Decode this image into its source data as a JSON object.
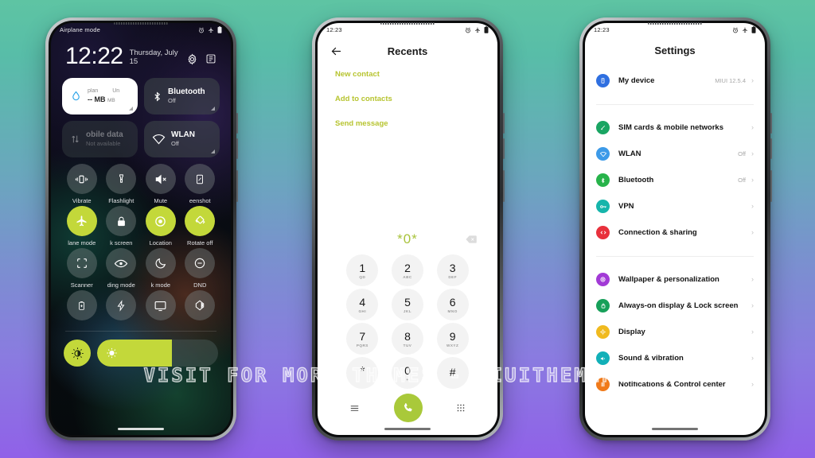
{
  "background": {
    "top_color": "#5ec4a3",
    "bottom_color": "#9061e8"
  },
  "watermark": {
    "text": "VISIT  FOR  MORE  THEMES  -  MIUITHEMER.COM"
  },
  "accent": {
    "lime": "#c3d83a",
    "lime_text": "#a9c33c"
  },
  "phone1": {
    "name": "control-center",
    "status": {
      "label": "Airplane mode",
      "icons": [
        "alarm-icon",
        "airplane-icon",
        "battery-icon"
      ]
    },
    "clock": {
      "time": "12:22",
      "date": "Thursday, July 15"
    },
    "header_icons": [
      "settings-gear-icon",
      "notes-icon"
    ],
    "big_tiles": [
      {
        "title": "plan",
        "title_right": "Un",
        "amount": "-- MB",
        "icon": "data-drop-icon",
        "style": "light"
      },
      {
        "title": "Bluetooth",
        "sub": "Off",
        "icon": "bluetooth-icon",
        "style": "dark"
      },
      {
        "title": "obile data",
        "sub": "Not available",
        "icon": "mobile-data-icon",
        "style": "dim"
      },
      {
        "title": "WLAN",
        "sub": "Off",
        "icon": "wifi-icon",
        "style": "dark"
      }
    ],
    "toggles": [
      {
        "label": "Vibrate",
        "icon": "vibrate-icon",
        "on": false
      },
      {
        "label": "Flashlight",
        "icon": "flashlight-icon",
        "on": false
      },
      {
        "label": "Mute",
        "icon": "mute-icon",
        "on": false
      },
      {
        "label": "eenshot",
        "icon": "screenshot-icon",
        "on": false
      },
      {
        "label": "lane mode",
        "icon": "airplane-icon",
        "on": true
      },
      {
        "label": "k screen",
        "icon": "lock-icon",
        "on": false
      },
      {
        "label": "Location",
        "icon": "location-icon",
        "on": true
      },
      {
        "label": "Rotate off",
        "icon": "rotate-icon",
        "on": true
      },
      {
        "label": "Scanner",
        "icon": "scanner-icon",
        "on": false
      },
      {
        "label": "ding mode",
        "icon": "eye-icon",
        "on": false
      },
      {
        "label": "k mode",
        "icon": "moon-icon",
        "on": false
      },
      {
        "label": "DND",
        "icon": "dnd-icon",
        "on": false
      },
      {
        "label": "",
        "icon": "battery-saver-icon",
        "on": false
      },
      {
        "label": "",
        "icon": "flash-icon",
        "on": false
      },
      {
        "label": "",
        "icon": "cast-icon",
        "on": false
      },
      {
        "label": "",
        "icon": "contrast-icon",
        "on": false
      }
    ],
    "brightness": {
      "button_icon": "auto-brightness-icon",
      "slider_icon": "sun-icon",
      "level_percent": 62
    }
  },
  "phone2": {
    "name": "dialer",
    "status": {
      "time": "12:23",
      "icons": [
        "alarm-icon",
        "airplane-icon",
        "battery-icon"
      ]
    },
    "title": "Recents",
    "back_icon": "back-arrow-icon",
    "links": [
      "New contact",
      "Add to contacts",
      "Send message"
    ],
    "dial_value": "*0*",
    "delete_icon": "backspace-icon",
    "keys": [
      {
        "num": "1",
        "sub": "QD"
      },
      {
        "num": "2",
        "sub": "ABC"
      },
      {
        "num": "3",
        "sub": "DEF"
      },
      {
        "num": "4",
        "sub": "GHI"
      },
      {
        "num": "5",
        "sub": "JKL"
      },
      {
        "num": "6",
        "sub": "MNO"
      },
      {
        "num": "7",
        "sub": "PQRS"
      },
      {
        "num": "8",
        "sub": "TUV"
      },
      {
        "num": "9",
        "sub": "WXYZ"
      },
      {
        "num": "*",
        "sub": ""
      },
      {
        "num": "0",
        "sub": "+"
      },
      {
        "num": "#",
        "sub": ""
      }
    ],
    "bottom": {
      "menu_icon": "menu-icon",
      "call_icon": "call-icon",
      "keypad_icon": "keypad-icon"
    }
  },
  "phone3": {
    "name": "settings",
    "status": {
      "time": "12:23",
      "icons": [
        "alarm-icon",
        "airplane-icon",
        "battery-icon"
      ]
    },
    "title": "Settings",
    "groups": [
      {
        "rows": [
          {
            "label": "My device",
            "value": "MIUI 12.5.4",
            "icon": "device-icon",
            "color": "#2f6fe0"
          }
        ]
      },
      {
        "rows": [
          {
            "label": "SIM cards & mobile networks",
            "value": "",
            "icon": "sim-icon",
            "color": "#1aa563"
          },
          {
            "label": "WLAN",
            "value": "Off",
            "icon": "wifi-icon",
            "color": "#3d9ae8"
          },
          {
            "label": "Bluetooth",
            "value": "Off",
            "icon": "bluetooth-icon",
            "color": "#27b34a"
          },
          {
            "label": "VPN",
            "value": "",
            "icon": "vpn-key-icon",
            "color": "#16b5ab"
          },
          {
            "label": "Connection & sharing",
            "value": "",
            "icon": "connection-icon",
            "color": "#e8313c"
          }
        ]
      },
      {
        "rows": [
          {
            "label": "Wallpaper & personalization",
            "value": "",
            "icon": "wallpaper-icon",
            "color": "#a23ad6"
          },
          {
            "label": "Always-on display & Lock screen",
            "value": "",
            "icon": "lock-icon",
            "color": "#17a05a"
          },
          {
            "label": "Display",
            "value": "",
            "icon": "display-icon",
            "color": "#f0ba1f"
          },
          {
            "label": "Sound & vibration",
            "value": "",
            "icon": "sound-icon",
            "color": "#12b0b8"
          },
          {
            "label": "Notifications & Control center",
            "value": "",
            "icon": "notification-icon",
            "color": "#f07a1a"
          }
        ]
      }
    ]
  }
}
